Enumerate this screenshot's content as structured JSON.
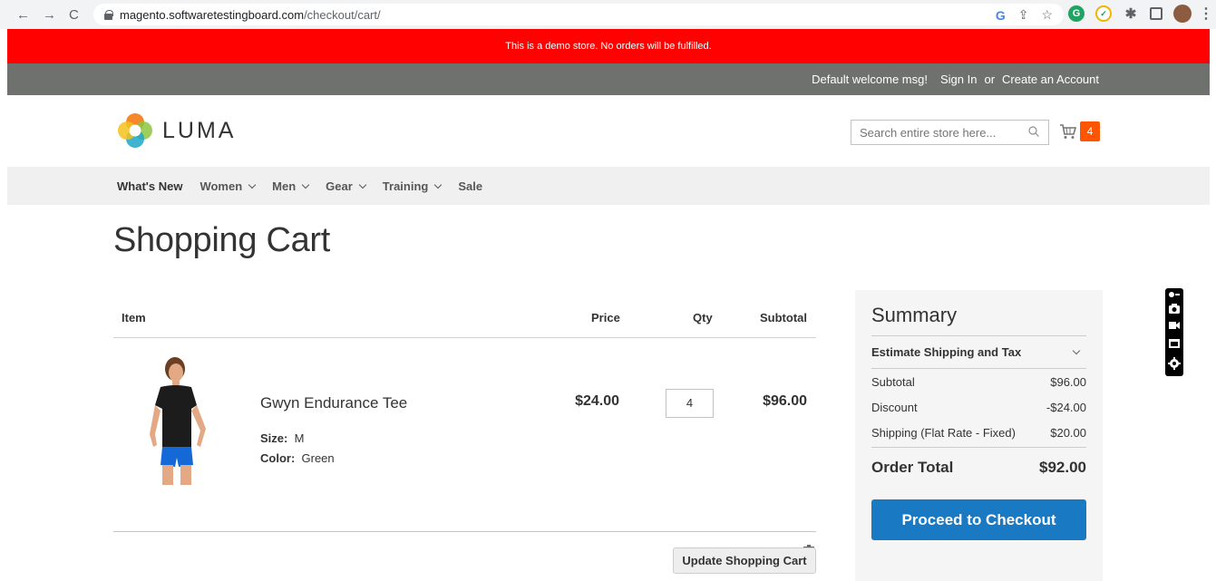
{
  "browser": {
    "url_host": "magento.softwaretestingboard.com",
    "url_path": "/checkout/cart/",
    "nav": {
      "back": "←",
      "forward": "→",
      "reload": "C"
    }
  },
  "banner": {
    "text": "This is a demo store. No orders will be fulfilled."
  },
  "header": {
    "welcome": "Default welcome msg!",
    "sign_in": "Sign In",
    "or": "or",
    "create_account": "Create an Account"
  },
  "logo": {
    "text": "LUMA"
  },
  "search": {
    "placeholder": "Search entire store here..."
  },
  "minicart": {
    "count": "4"
  },
  "nav": {
    "items": [
      {
        "label": "What's New",
        "has_dropdown": false
      },
      {
        "label": "Women",
        "has_dropdown": true
      },
      {
        "label": "Men",
        "has_dropdown": true
      },
      {
        "label": "Gear",
        "has_dropdown": true
      },
      {
        "label": "Training",
        "has_dropdown": true
      },
      {
        "label": "Sale",
        "has_dropdown": false
      }
    ]
  },
  "page": {
    "title": "Shopping Cart"
  },
  "cart": {
    "headers": {
      "item": "Item",
      "price": "Price",
      "qty": "Qty",
      "subtotal": "Subtotal"
    },
    "items": [
      {
        "name": "Gwyn Endurance Tee",
        "size_label": "Size:",
        "size": "M",
        "color_label": "Color:",
        "color": "Green",
        "price": "$24.00",
        "qty": "4",
        "subtotal": "$96.00"
      }
    ],
    "update_button": "Update Shopping Cart"
  },
  "summary": {
    "title": "Summary",
    "estimate": "Estimate Shipping and Tax",
    "rows": [
      {
        "label": "Subtotal",
        "value": "$96.00"
      },
      {
        "label": "Discount",
        "value": "-$24.00"
      },
      {
        "label": "Shipping (Flat Rate - Fixed)",
        "value": "$20.00"
      }
    ],
    "order_total_label": "Order Total",
    "order_total": "$92.00",
    "checkout_button": "Proceed to Checkout"
  },
  "colors": {
    "banner": "#ff0101",
    "header_bar": "#6e716e",
    "cart_badge": "#ff5501",
    "checkout_button": "#1979c3"
  }
}
